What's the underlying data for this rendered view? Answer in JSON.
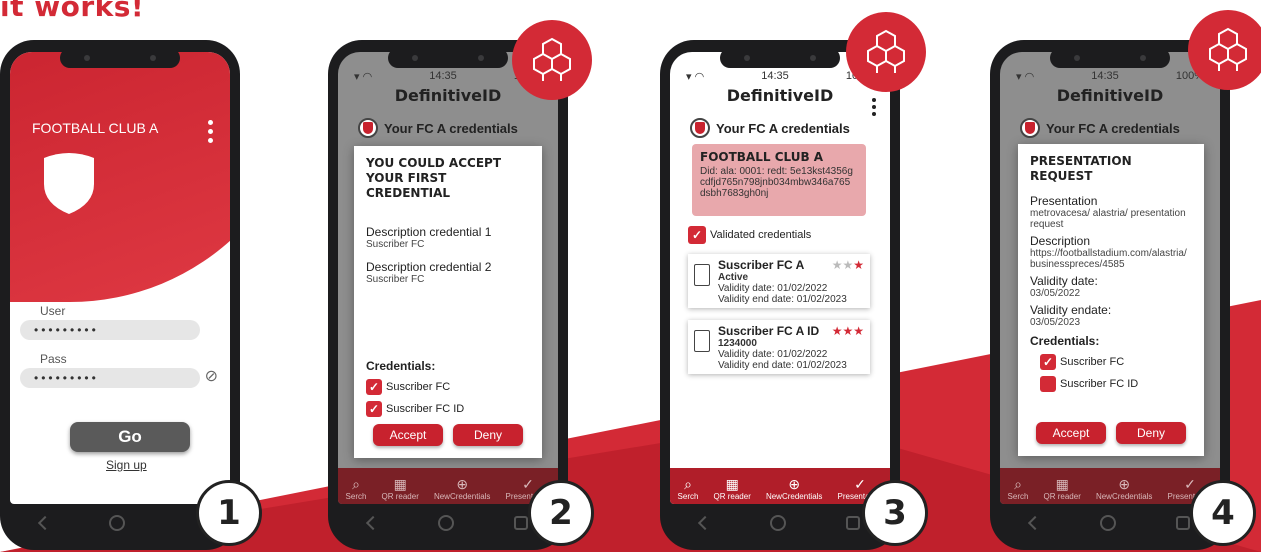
{
  "headline": "it works!",
  "status": {
    "time": "14:35",
    "battery": "100%"
  },
  "badges": [
    "1",
    "2",
    "3",
    "4"
  ],
  "app_title": "DefinitiveID",
  "phone1": {
    "club_name": "FOOTBALL CLUB A",
    "user_label": "User",
    "user_value": "•••••••••",
    "pass_label": "Pass",
    "pass_value": "•••••••••",
    "go_label": "Go",
    "signup_label": "Sign up"
  },
  "phone2": {
    "cred_header": "Your FC A credentials",
    "modal_title_line1": "YOU COULD ACCEPT",
    "modal_title_line2": "YOUR FIRST CREDENTIAL",
    "desc1_title": "Description credential 1",
    "desc1_value": "Suscriber FC",
    "desc2_title": "Description credential 2",
    "desc2_value": "Suscriber FC",
    "credentials_label": "Credentials:",
    "check1": "Suscriber FC",
    "check2": "Suscriber FC ID",
    "accept": "Accept",
    "deny": "Deny"
  },
  "phone3": {
    "cred_header": "Your FC A credentials",
    "card_title": "FOOTBALL CLUB A",
    "card_did": "Did: ala: 0001: redt: 5e13kst4356g cdfjd765n798jnb034mbw346a765 dsbh7683gh0nj",
    "validated_label": "Validated credentials",
    "cred1": {
      "title": "Suscriber FC A",
      "sub": "Active",
      "l1": "Validity date: 01/02/2022",
      "l2": "Validity end date: 01/02/2023",
      "stars": 1
    },
    "cred2": {
      "title": "Suscriber FC A ID",
      "sub": "1234000",
      "l1": "Validity date: 01/02/2022",
      "l2": "Validity end date: 01/02/2023",
      "stars": 3
    }
  },
  "phone4": {
    "cred_header": "Your FC A credentials",
    "modal_title_line1": "PRESENTATION",
    "modal_title_line2": "REQUEST",
    "pres_title": "Presentation",
    "pres_value": "metrovacesa/ alastria/ presentation request",
    "desc_title": "Description",
    "desc_value": "https://footballstadium.com/alastria/ businesspreces/4585",
    "validity_title": "Validity date:",
    "validity_value": "03/05/2022",
    "endate_title": "Validity endate:",
    "endate_value": "03/05/2023",
    "credentials_label": "Credentials:",
    "check1": "Suscriber FC",
    "check2": "Suscriber FC ID",
    "accept": "Accept",
    "deny": "Deny"
  },
  "bottom_nav": {
    "search": "Serch",
    "qr": "QR reader",
    "newcred": "NewCredentials",
    "present": "Presentation"
  },
  "colors": {
    "brand_red": "#d32a36",
    "dark_red": "#b01e29",
    "phone_body": "#1c1c1e"
  }
}
